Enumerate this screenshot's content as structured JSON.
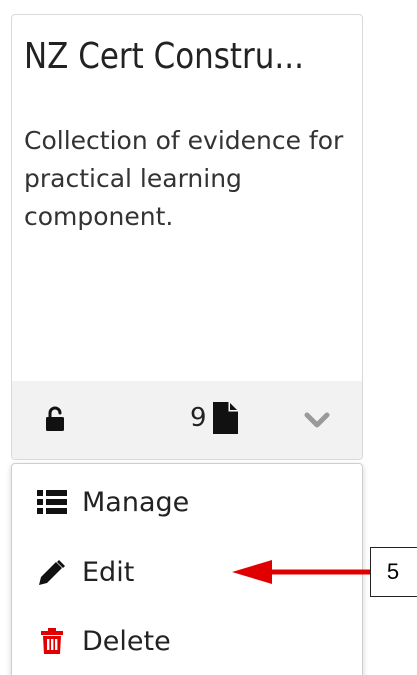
{
  "card": {
    "title": "NZ Cert Constru...",
    "description": "Collection of evidence for practical learning component.",
    "page_count": "9"
  },
  "menu": {
    "items": [
      {
        "label": "Manage",
        "icon": "list-icon"
      },
      {
        "label": "Edit",
        "icon": "pencil-icon"
      },
      {
        "label": "Delete",
        "icon": "trash-icon"
      }
    ]
  },
  "annotation": {
    "callout_number": "5"
  },
  "colors": {
    "footer_bg": "#f2f2f2",
    "delete_icon": "#e00000",
    "arrow": "#e00000",
    "chevron": "#9a9a9a",
    "text": "#222222"
  }
}
